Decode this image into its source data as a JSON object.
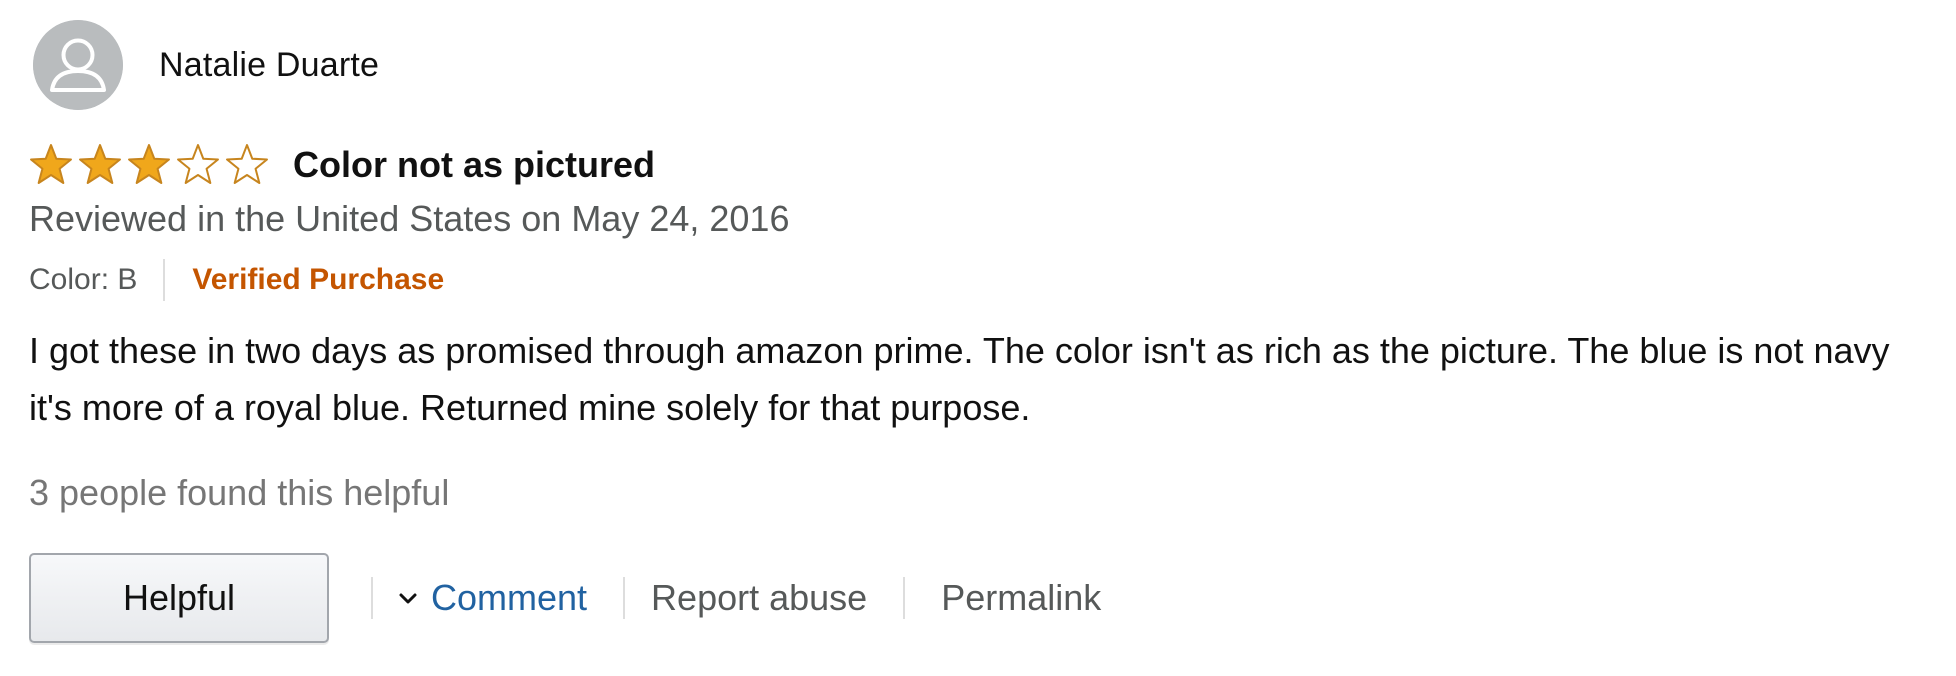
{
  "review": {
    "profile_name": "Natalie Duarte",
    "avatar_icon": "default-user-avatar-icon",
    "rating": 3,
    "rating_max": 5,
    "star_color": "#f0a71b",
    "star_outline_color": "#c7851e",
    "title": "Color not as pictured",
    "date_line": "Reviewed in the United States on May 24, 2016",
    "variant": "Color: B",
    "verified_label": "Verified Purchase",
    "verified_color": "#c45500",
    "body": "I got these in two days as promised through amazon prime. The color isn't as rich as the picture. The blue is not navy it's more of a royal blue. Returned mine solely for that purpose.",
    "helpful_count_text": "3 people found this helpful"
  },
  "actions": {
    "helpful_label": "Helpful",
    "comment_label": "Comment",
    "comment_icon": "chevron-down-icon",
    "report_label": "Report abuse",
    "permalink_label": "Permalink",
    "link_color": "#2162a1"
  }
}
